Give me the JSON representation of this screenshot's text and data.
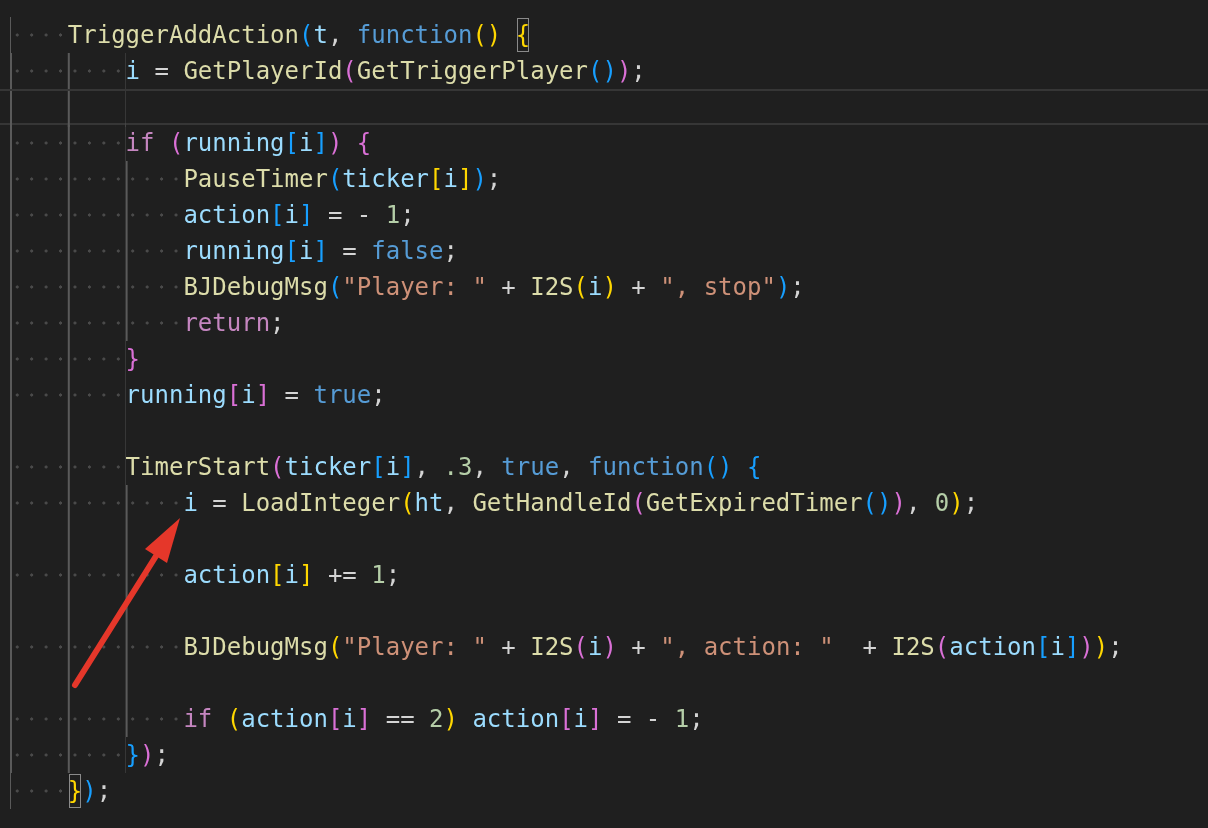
{
  "editor": {
    "lines": [
      {
        "kind": "code",
        "current": false,
        "tokens": [
          {
            "kind": "function",
            "text": "TriggerAddAction"
          },
          {
            "kind": "bracket-3",
            "text": "("
          },
          {
            "kind": "variable",
            "text": "t"
          },
          {
            "kind": "punct",
            "text": ", "
          },
          {
            "kind": "keyword",
            "text": "function"
          },
          {
            "kind": "bracket-1",
            "text": "() "
          },
          {
            "kind": "bracket-1-matched",
            "text": "{"
          }
        ],
        "children": [
          {
            "kind": "code",
            "current": false,
            "tokens": [
              {
                "kind": "variable",
                "text": "i"
              },
              {
                "kind": "punct",
                "text": " = "
              },
              {
                "kind": "function",
                "text": "GetPlayerId"
              },
              {
                "kind": "bracket-2",
                "text": "("
              },
              {
                "kind": "function",
                "text": "GetTriggerPlayer"
              },
              {
                "kind": "bracket-3",
                "text": "()"
              },
              {
                "kind": "bracket-2",
                "text": ")"
              },
              {
                "kind": "punct",
                "text": ";"
              }
            ]
          },
          {
            "kind": "blank",
            "current": true
          },
          {
            "kind": "code",
            "current": false,
            "tokens": [
              {
                "kind": "control",
                "text": "if "
              },
              {
                "kind": "bracket-2",
                "text": "("
              },
              {
                "kind": "variable",
                "text": "running"
              },
              {
                "kind": "bracket-3",
                "text": "["
              },
              {
                "kind": "variable",
                "text": "i"
              },
              {
                "kind": "bracket-3",
                "text": "]"
              },
              {
                "kind": "bracket-2",
                "text": ") "
              },
              {
                "kind": "bracket-2",
                "text": "{"
              }
            ],
            "children": [
              {
                "kind": "code",
                "current": false,
                "tokens": [
                  {
                    "kind": "function",
                    "text": "PauseTimer"
                  },
                  {
                    "kind": "bracket-3",
                    "text": "("
                  },
                  {
                    "kind": "variable",
                    "text": "ticker"
                  },
                  {
                    "kind": "bracket-1",
                    "text": "["
                  },
                  {
                    "kind": "variable",
                    "text": "i"
                  },
                  {
                    "kind": "bracket-1",
                    "text": "]"
                  },
                  {
                    "kind": "bracket-3",
                    "text": ")"
                  },
                  {
                    "kind": "punct",
                    "text": ";"
                  }
                ]
              },
              {
                "kind": "code",
                "current": false,
                "tokens": [
                  {
                    "kind": "variable",
                    "text": "action"
                  },
                  {
                    "kind": "bracket-3",
                    "text": "["
                  },
                  {
                    "kind": "variable",
                    "text": "i"
                  },
                  {
                    "kind": "bracket-3",
                    "text": "]"
                  },
                  {
                    "kind": "punct",
                    "text": " = - "
                  },
                  {
                    "kind": "number",
                    "text": "1"
                  },
                  {
                    "kind": "punct",
                    "text": ";"
                  }
                ]
              },
              {
                "kind": "code",
                "current": false,
                "tokens": [
                  {
                    "kind": "variable",
                    "text": "running"
                  },
                  {
                    "kind": "bracket-3",
                    "text": "["
                  },
                  {
                    "kind": "variable",
                    "text": "i"
                  },
                  {
                    "kind": "bracket-3",
                    "text": "]"
                  },
                  {
                    "kind": "punct",
                    "text": " = "
                  },
                  {
                    "kind": "keyword",
                    "text": "false"
                  },
                  {
                    "kind": "punct",
                    "text": ";"
                  }
                ]
              },
              {
                "kind": "code",
                "current": false,
                "tokens": [
                  {
                    "kind": "function",
                    "text": "BJDebugMsg"
                  },
                  {
                    "kind": "bracket-3",
                    "text": "("
                  },
                  {
                    "kind": "string",
                    "text": "\"Player: \""
                  },
                  {
                    "kind": "punct",
                    "text": " + "
                  },
                  {
                    "kind": "function",
                    "text": "I2S"
                  },
                  {
                    "kind": "bracket-1",
                    "text": "("
                  },
                  {
                    "kind": "variable",
                    "text": "i"
                  },
                  {
                    "kind": "bracket-1",
                    "text": ")"
                  },
                  {
                    "kind": "punct",
                    "text": " + "
                  },
                  {
                    "kind": "string",
                    "text": "\", stop\""
                  },
                  {
                    "kind": "bracket-3",
                    "text": ")"
                  },
                  {
                    "kind": "punct",
                    "text": ";"
                  }
                ]
              },
              {
                "kind": "code",
                "current": false,
                "tokens": [
                  {
                    "kind": "control",
                    "text": "return"
                  },
                  {
                    "kind": "punct",
                    "text": ";"
                  }
                ]
              }
            ]
          },
          {
            "kind": "code",
            "current": false,
            "tokens": [
              {
                "kind": "bracket-2",
                "text": "}"
              }
            ]
          },
          {
            "kind": "code",
            "current": false,
            "tokens": [
              {
                "kind": "variable",
                "text": "running"
              },
              {
                "kind": "bracket-2",
                "text": "["
              },
              {
                "kind": "variable",
                "text": "i"
              },
              {
                "kind": "bracket-2",
                "text": "]"
              },
              {
                "kind": "punct",
                "text": " = "
              },
              {
                "kind": "keyword",
                "text": "true"
              },
              {
                "kind": "punct",
                "text": ";"
              }
            ]
          },
          {
            "kind": "blank",
            "current": false
          },
          {
            "kind": "code",
            "current": false,
            "tokens": [
              {
                "kind": "function",
                "text": "TimerStart"
              },
              {
                "kind": "bracket-2",
                "text": "("
              },
              {
                "kind": "variable",
                "text": "ticker"
              },
              {
                "kind": "bracket-3",
                "text": "["
              },
              {
                "kind": "variable",
                "text": "i"
              },
              {
                "kind": "bracket-3",
                "text": "]"
              },
              {
                "kind": "punct",
                "text": ", "
              },
              {
                "kind": "number",
                "text": ".3"
              },
              {
                "kind": "punct",
                "text": ", "
              },
              {
                "kind": "keyword",
                "text": "true"
              },
              {
                "kind": "punct",
                "text": ", "
              },
              {
                "kind": "keyword",
                "text": "function"
              },
              {
                "kind": "bracket-3",
                "text": "() "
              },
              {
                "kind": "bracket-3",
                "text": "{"
              }
            ],
            "children": [
              {
                "kind": "code",
                "current": false,
                "tokens": [
                  {
                    "kind": "variable",
                    "text": "i"
                  },
                  {
                    "kind": "punct",
                    "text": " = "
                  },
                  {
                    "kind": "function",
                    "text": "LoadInteger"
                  },
                  {
                    "kind": "bracket-1",
                    "text": "("
                  },
                  {
                    "kind": "variable",
                    "text": "ht"
                  },
                  {
                    "kind": "punct",
                    "text": ", "
                  },
                  {
                    "kind": "function",
                    "text": "GetHandleId"
                  },
                  {
                    "kind": "bracket-2",
                    "text": "("
                  },
                  {
                    "kind": "function",
                    "text": "GetExpiredTimer"
                  },
                  {
                    "kind": "bracket-3",
                    "text": "()"
                  },
                  {
                    "kind": "bracket-2",
                    "text": ")"
                  },
                  {
                    "kind": "punct",
                    "text": ", "
                  },
                  {
                    "kind": "number",
                    "text": "0"
                  },
                  {
                    "kind": "bracket-1",
                    "text": ")"
                  },
                  {
                    "kind": "punct",
                    "text": ";"
                  }
                ]
              },
              {
                "kind": "blank",
                "current": false
              },
              {
                "kind": "code",
                "current": false,
                "tokens": [
                  {
                    "kind": "variable",
                    "text": "action"
                  },
                  {
                    "kind": "bracket-1",
                    "text": "["
                  },
                  {
                    "kind": "variable",
                    "text": "i"
                  },
                  {
                    "kind": "bracket-1",
                    "text": "]"
                  },
                  {
                    "kind": "punct",
                    "text": " += "
                  },
                  {
                    "kind": "number",
                    "text": "1"
                  },
                  {
                    "kind": "punct",
                    "text": ";"
                  }
                ]
              },
              {
                "kind": "blank",
                "current": false
              },
              {
                "kind": "code",
                "current": false,
                "tokens": [
                  {
                    "kind": "function",
                    "text": "BJDebugMsg"
                  },
                  {
                    "kind": "bracket-1",
                    "text": "("
                  },
                  {
                    "kind": "string",
                    "text": "\"Player: \""
                  },
                  {
                    "kind": "punct",
                    "text": " + "
                  },
                  {
                    "kind": "function",
                    "text": "I2S"
                  },
                  {
                    "kind": "bracket-2",
                    "text": "("
                  },
                  {
                    "kind": "variable",
                    "text": "i"
                  },
                  {
                    "kind": "bracket-2",
                    "text": ")"
                  },
                  {
                    "kind": "punct",
                    "text": " + "
                  },
                  {
                    "kind": "string",
                    "text": "\", action: \""
                  },
                  {
                    "kind": "punct",
                    "text": "  + "
                  },
                  {
                    "kind": "function",
                    "text": "I2S"
                  },
                  {
                    "kind": "bracket-2",
                    "text": "("
                  },
                  {
                    "kind": "variable",
                    "text": "action"
                  },
                  {
                    "kind": "bracket-3",
                    "text": "["
                  },
                  {
                    "kind": "variable",
                    "text": "i"
                  },
                  {
                    "kind": "bracket-3",
                    "text": "]"
                  },
                  {
                    "kind": "bracket-2",
                    "text": ")"
                  },
                  {
                    "kind": "bracket-1",
                    "text": ")"
                  },
                  {
                    "kind": "punct",
                    "text": ";"
                  }
                ]
              },
              {
                "kind": "blank",
                "current": false
              },
              {
                "kind": "code",
                "current": false,
                "tokens": [
                  {
                    "kind": "control",
                    "text": "if "
                  },
                  {
                    "kind": "bracket-1",
                    "text": "("
                  },
                  {
                    "kind": "variable",
                    "text": "action"
                  },
                  {
                    "kind": "bracket-2",
                    "text": "["
                  },
                  {
                    "kind": "variable",
                    "text": "i"
                  },
                  {
                    "kind": "bracket-2",
                    "text": "]"
                  },
                  {
                    "kind": "punct",
                    "text": " == "
                  },
                  {
                    "kind": "number",
                    "text": "2"
                  },
                  {
                    "kind": "bracket-1",
                    "text": ") "
                  },
                  {
                    "kind": "variable",
                    "text": "action"
                  },
                  {
                    "kind": "bracket-2",
                    "text": "["
                  },
                  {
                    "kind": "variable",
                    "text": "i"
                  },
                  {
                    "kind": "bracket-2",
                    "text": "]"
                  },
                  {
                    "kind": "punct",
                    "text": " = - "
                  },
                  {
                    "kind": "number",
                    "text": "1"
                  },
                  {
                    "kind": "punct",
                    "text": ";"
                  }
                ]
              }
            ]
          },
          {
            "kind": "code",
            "current": false,
            "tokens": [
              {
                "kind": "bracket-3",
                "text": "}"
              },
              {
                "kind": "bracket-2",
                "text": ")"
              },
              {
                "kind": "punct",
                "text": ";"
              }
            ]
          }
        ]
      },
      {
        "kind": "code",
        "current": false,
        "tokens": [
          {
            "kind": "bracket-1-matched",
            "text": "}"
          },
          {
            "kind": "bracket-3",
            "text": ")"
          },
          {
            "kind": "punct",
            "text": ";"
          }
        ]
      }
    ]
  }
}
